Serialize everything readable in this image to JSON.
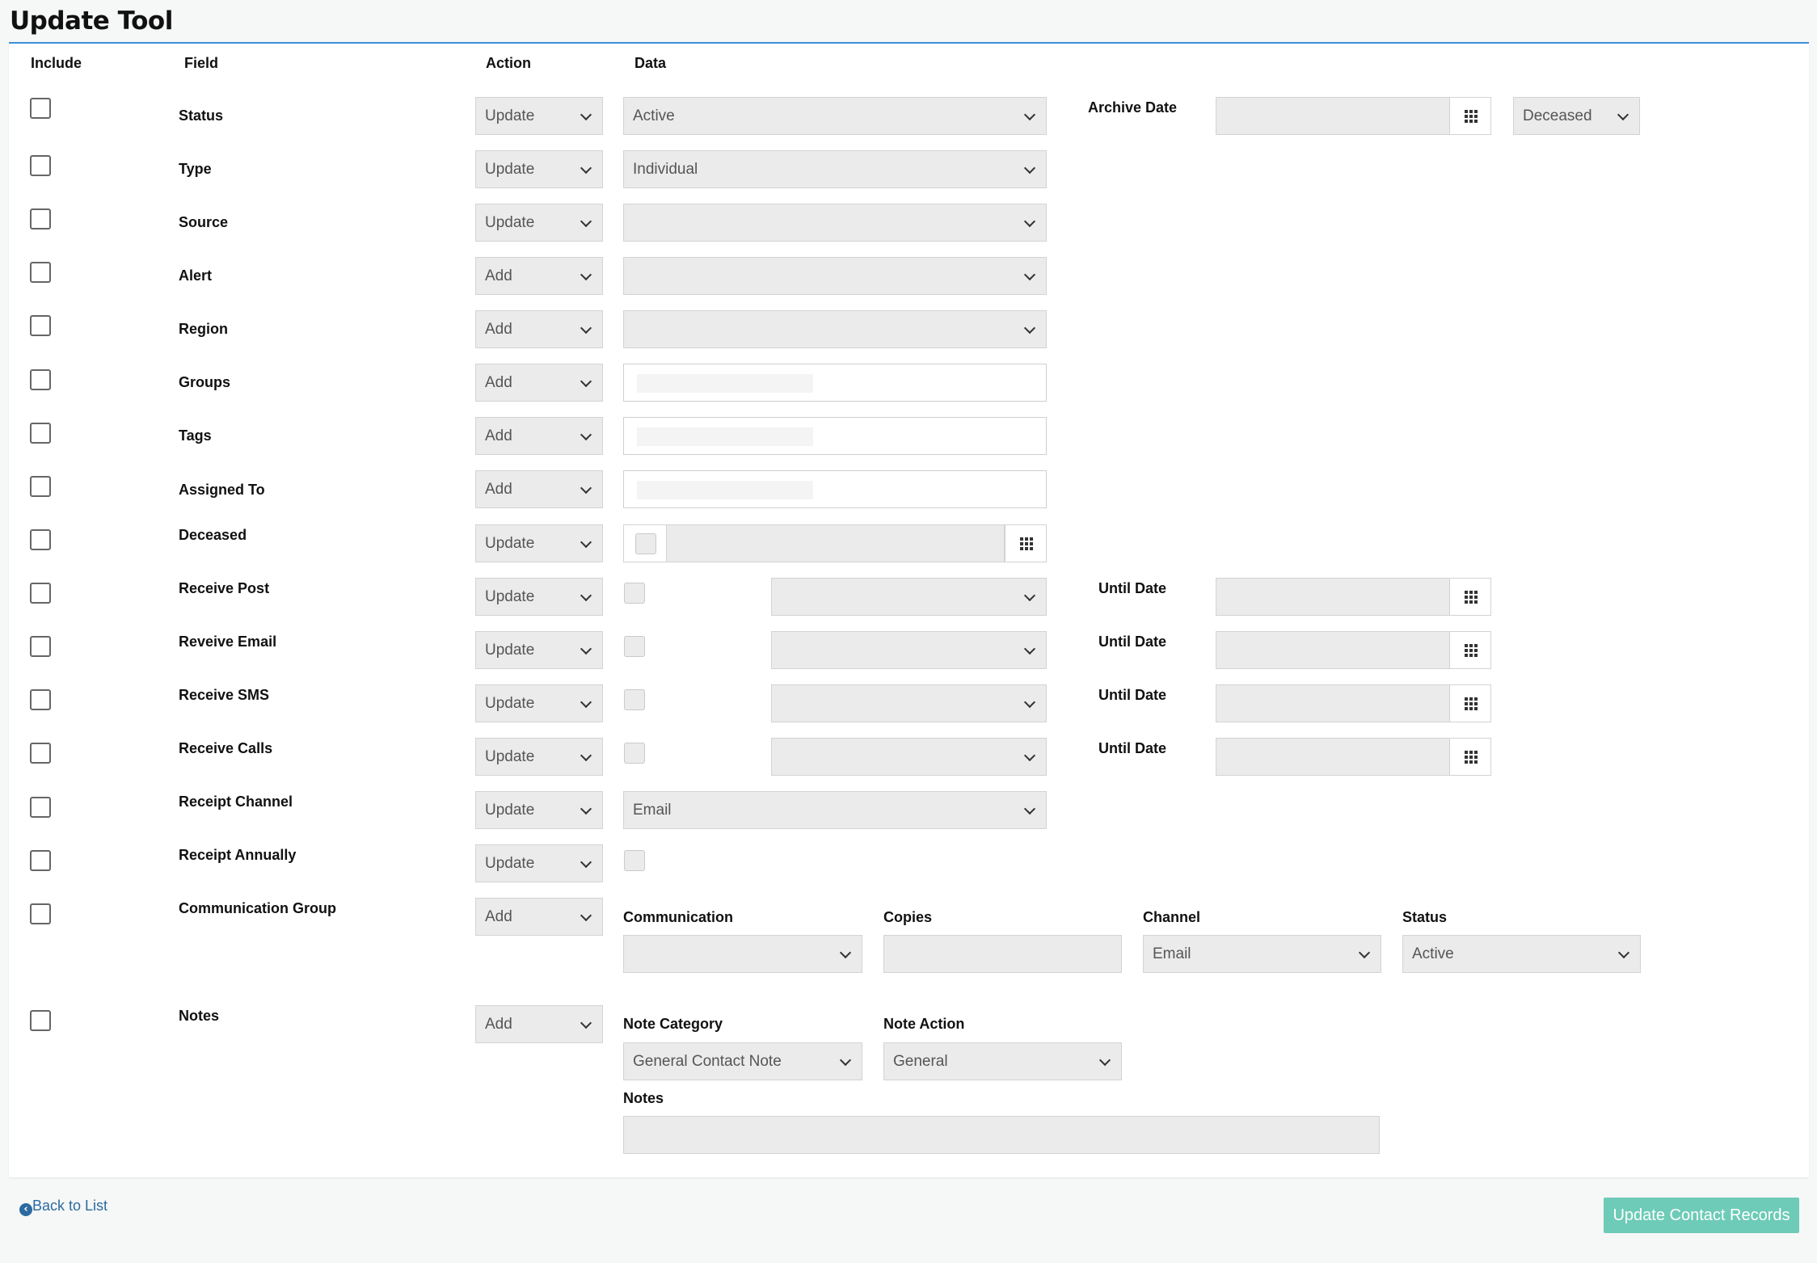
{
  "page": {
    "title": "Update Tool"
  },
  "headers": {
    "include": "Include",
    "field": "Field",
    "action": "Action",
    "data": "Data"
  },
  "rows": {
    "status": {
      "label": "Status",
      "action": "Update",
      "value": "Active",
      "archive_label": "Archive Date",
      "archive_reason": "Deceased"
    },
    "type": {
      "label": "Type",
      "action": "Update",
      "value": "Individual"
    },
    "source": {
      "label": "Source",
      "action": "Update",
      "value": ""
    },
    "alert": {
      "label": "Alert",
      "action": "Add",
      "value": ""
    },
    "region": {
      "label": "Region",
      "action": "Add",
      "value": ""
    },
    "groups": {
      "label": "Groups",
      "action": "Add"
    },
    "tags": {
      "label": "Tags",
      "action": "Add"
    },
    "assigned_to": {
      "label": "Assigned To",
      "action": "Add"
    },
    "deceased": {
      "label": "Deceased",
      "action": "Update"
    },
    "receive_post": {
      "label": "Receive Post",
      "action": "Update",
      "until_label": "Until Date"
    },
    "receive_email": {
      "label": "Reveive Email",
      "action": "Update",
      "until_label": "Until Date"
    },
    "receive_sms": {
      "label": "Receive SMS",
      "action": "Update",
      "until_label": "Until Date"
    },
    "receive_calls": {
      "label": "Receive Calls",
      "action": "Update",
      "until_label": "Until Date"
    },
    "receipt_channel": {
      "label": "Receipt Channel",
      "action": "Update",
      "value": "Email"
    },
    "receipt_annually": {
      "label": "Receipt Annually",
      "action": "Update"
    },
    "communication_group": {
      "label": "Communication Group",
      "action": "Add",
      "communication_label": "Communication",
      "copies_label": "Copies",
      "channel_label": "Channel",
      "channel_value": "Email",
      "status_label": "Status",
      "status_value": "Active"
    },
    "notes": {
      "label": "Notes",
      "action": "Add",
      "category_label": "Note Category",
      "category_value": "General Contact Note",
      "note_action_label": "Note Action",
      "note_action_value": "General",
      "notes_label": "Notes"
    }
  },
  "footer": {
    "back_label": "Back to List",
    "back_icon": "arrow-circle-left-icon",
    "submit_label": "Update Contact Records",
    "submit_color": "#6dcbb7"
  }
}
